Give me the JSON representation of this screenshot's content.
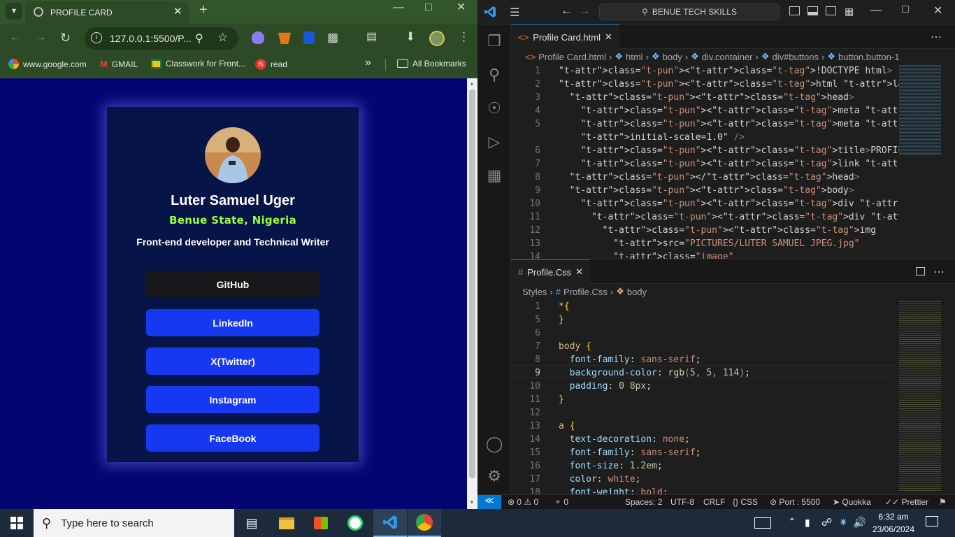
{
  "browser": {
    "tab_title": "PROFILE CARD",
    "url": "127.0.0.1:5500/P...",
    "bookmarks": [
      "www.google.com",
      "GMAIL",
      "Classwork for Front...",
      "read"
    ],
    "all_bookmarks": "All Bookmarks",
    "new_tab": "+",
    "overflow": "»"
  },
  "profile": {
    "name": "Luter Samuel Uger",
    "location": "Benue State, Nigeria",
    "bio": "Front-end developer and Technical Writer",
    "links": [
      "GitHub",
      "LinkedIn",
      "X(Twitter)",
      "Instagram",
      "FaceBook"
    ],
    "page_background": "rgb(5,5,114)"
  },
  "vscode": {
    "search": "BENUE TECH SKILLS",
    "html_tab": "Profile Card.html",
    "html_crumbs": [
      "Profile Card.html",
      "html",
      "body",
      "div.container",
      "div#buttons",
      "button.button-1"
    ],
    "css_tab": "Profile.Css",
    "css_crumbs": [
      "Styles",
      "Profile.Css",
      "body"
    ],
    "html_lines": [
      {
        "n": "1",
        "code": "<!DOCTYPE html>"
      },
      {
        "n": "2",
        "code": "<html lang=\"en\">"
      },
      {
        "n": "3",
        "code": "  <head>"
      },
      {
        "n": "4",
        "code": "    <meta charset=\"UTF-8\" />"
      },
      {
        "n": "5",
        "code": "    <meta name=\"viewport\" content=\"width=device-width,"
      },
      {
        "n": "",
        "code": "    initial-scale=1.0\" />"
      },
      {
        "n": "6",
        "code": "    <title>PROFILE CARD</title>"
      },
      {
        "n": "7",
        "code": "    <link rel=\"stylesheet\" href=\"Styles/Profile.Css\" />"
      },
      {
        "n": "8",
        "code": "  </head>"
      },
      {
        "n": "9",
        "code": "  <body>"
      },
      {
        "n": "10",
        "code": "    <div class=\"container\">"
      },
      {
        "n": "11",
        "code": "      <div id=\"header\">"
      },
      {
        "n": "12",
        "code": "        <img"
      },
      {
        "n": "13",
        "code": "          src=\"PICTURES/LUTER SAMUEL JPEG.jpg\""
      },
      {
        "n": "14",
        "code": "          class=\"image\""
      }
    ],
    "css_lines": [
      {
        "n": "1",
        "code": "*{"
      },
      {
        "n": "5",
        "code": "}"
      },
      {
        "n": "6",
        "code": ""
      },
      {
        "n": "7",
        "code": "body {"
      },
      {
        "n": "8",
        "code": "  font-family: sans-serif;"
      },
      {
        "n": "9",
        "code": "  background-color: rgb(5, 5, 114);"
      },
      {
        "n": "10",
        "code": "  padding: 0 8px;"
      },
      {
        "n": "11",
        "code": "}"
      },
      {
        "n": "12",
        "code": ""
      },
      {
        "n": "13",
        "code": "a {"
      },
      {
        "n": "14",
        "code": "  text-decoration: none;"
      },
      {
        "n": "15",
        "code": "  font-family: sans-serif;"
      },
      {
        "n": "16",
        "code": "  font-size: 1.2em;"
      },
      {
        "n": "17",
        "code": "  color: white;"
      },
      {
        "n": "18",
        "code": "  font-weight: bold;"
      }
    ],
    "status": {
      "errors": "0",
      "warnings": "0",
      "ports": "0",
      "spaces": "Spaces: 2",
      "encoding": "UTF-8",
      "eol": "CRLF",
      "language": "CSS",
      "port": "Port : 5500",
      "quokka": "Quokka",
      "prettier": "Prettier"
    }
  },
  "taskbar": {
    "search_placeholder": "Type here to search",
    "time": "6:32 am",
    "date": "23/06/2024"
  }
}
